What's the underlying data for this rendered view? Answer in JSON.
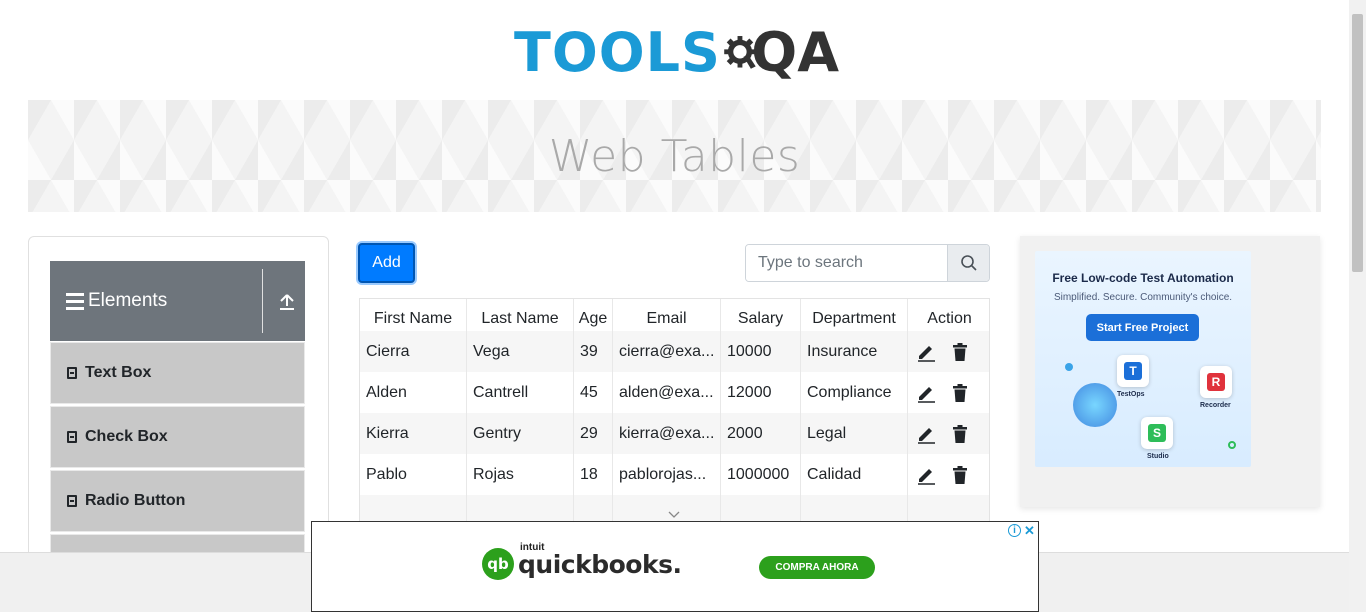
{
  "brand": {
    "tools": "TOOLS",
    "qa": "QA"
  },
  "page_title": "Web Tables",
  "sidebar": {
    "group_title": "Elements",
    "items": [
      {
        "label": "Text Box"
      },
      {
        "label": "Check Box"
      },
      {
        "label": "Radio Button"
      }
    ]
  },
  "toolbar": {
    "add_label": "Add",
    "search_placeholder": "Type to search"
  },
  "table": {
    "headers": [
      "First Name",
      "Last Name",
      "Age",
      "Email",
      "Salary",
      "Department",
      "Action"
    ],
    "rows": [
      [
        "Cierra",
        "Vega",
        "39",
        "cierra@exa...",
        "10000",
        "Insurance"
      ],
      [
        "Alden",
        "Cantrell",
        "45",
        "alden@exa...",
        "12000",
        "Compliance"
      ],
      [
        "Kierra",
        "Gentry",
        "29",
        "kierra@exa...",
        "2000",
        "Legal"
      ],
      [
        "Pablo",
        "Rojas",
        "18",
        "pablorojas...",
        "1000000",
        "Calidad"
      ]
    ]
  },
  "right_ad": {
    "title": "Free Low-code Test Automation",
    "subtitle": "Simplified. Secure. Community's choice.",
    "cta": "Start Free Project",
    "labels": {
      "testops": "TestOps",
      "recorder": "Recorder",
      "studio": "Studio"
    }
  },
  "bottom_ad": {
    "intuit": "intuit",
    "brand": "quickbooks.",
    "cta": "COMPRA AHORA"
  },
  "colors": {
    "brand_blue": "#1b9ad6",
    "primary": "#007bff",
    "menu_header": "#6e757c",
    "qb_green": "#2ca01c"
  }
}
